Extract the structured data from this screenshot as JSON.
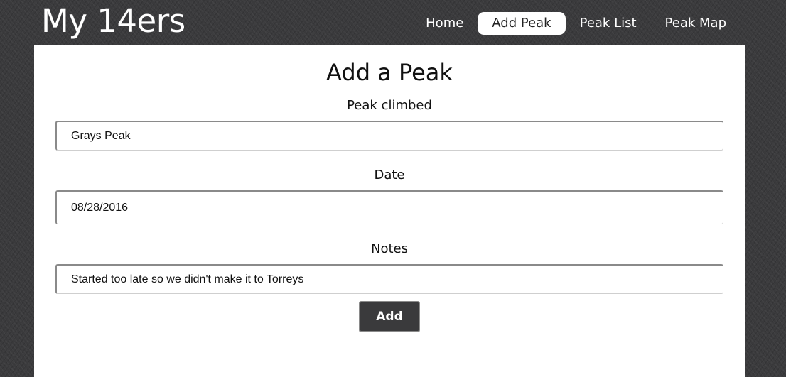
{
  "header": {
    "site_title": "My 14ers",
    "nav": [
      {
        "label": "Home",
        "active": false
      },
      {
        "label": "Add Peak",
        "active": true
      },
      {
        "label": "Peak List",
        "active": false
      },
      {
        "label": "Peak Map",
        "active": false
      }
    ]
  },
  "form": {
    "title": "Add a Peak",
    "peak": {
      "label": "Peak climbed",
      "value": "Grays Peak"
    },
    "date": {
      "label": "Date",
      "value": "08/28/2016"
    },
    "notes": {
      "label": "Notes",
      "value": "Started too late so we didn't make it to Torreys"
    },
    "submit_label": "Add"
  },
  "colors": {
    "background": "#3a3a3c",
    "panel": "#ffffff",
    "button": "#3a3a3c",
    "nav_active_bg": "#ffffff"
  }
}
